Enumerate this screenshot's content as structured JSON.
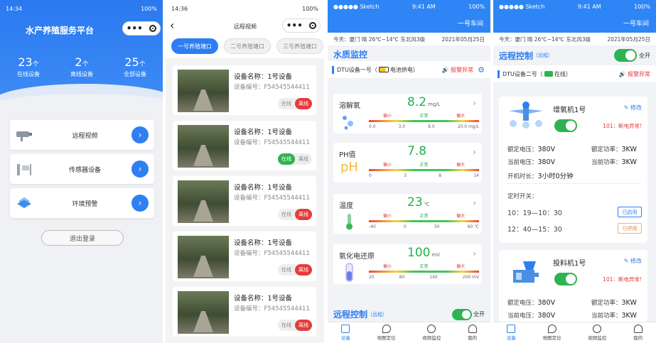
{
  "s1": {
    "time": "14:34",
    "battery": "100%",
    "title": "水产养殖服务平台",
    "stats": [
      {
        "n": "23",
        "u": "个",
        "l": "在线设备"
      },
      {
        "n": "2",
        "u": "个",
        "l": "离线设备"
      },
      {
        "n": "25",
        "u": "个",
        "l": "全部设备"
      }
    ],
    "menu": [
      {
        "label": "远程视频",
        "icon": "camera-icon"
      },
      {
        "label": "传感器设备",
        "icon": "sensor-icon"
      },
      {
        "label": "环境预警",
        "icon": "alert-icon"
      }
    ],
    "logout": "退出登录",
    "go": "›"
  },
  "s2": {
    "time": "14:36",
    "battery": "100%",
    "title": "远程视频",
    "back": "‹",
    "tabs": [
      "一号养殖塘口",
      "二号养殖塘口",
      "三号养殖塘口"
    ],
    "cards": [
      {
        "name": "设备名称：1号设备",
        "code": "设备编号：F54545544411",
        "online": "在线",
        "offline": "离线",
        "state": "offline"
      },
      {
        "name": "设备名称：1号设备",
        "code": "设备编号：F54545544411",
        "online": "在线",
        "offline": "离线",
        "state": "online"
      },
      {
        "name": "设备名称：1号设备",
        "code": "设备编号：F54545544411",
        "online": "在线",
        "offline": "离线",
        "state": "offline"
      },
      {
        "name": "设备名称：1号设备",
        "code": "设备编号：F54545544411",
        "online": "在线",
        "offline": "离线",
        "state": "offline"
      },
      {
        "name": "设备名称：1号设备",
        "code": "设备编号：F54545544411",
        "online": "在线",
        "offline": "离线",
        "state": "offline"
      }
    ]
  },
  "s3": {
    "carrier": "●●●●● Sketch",
    "time": "9:41 AM",
    "battery": "100%",
    "workshop": "一号车间",
    "weather": "今天：厦门 晴 26℃~14℃ 东北风3级",
    "date": "2021年05月25日",
    "section": "水质监控",
    "dtu": "DTU设备一号（",
    "power": "电池供电）",
    "alarm": "报警异常",
    "metrics": [
      {
        "name": "溶解氧",
        "value": "8.2",
        "unit": "mg/L",
        "low": "偏小",
        "mid": "正常",
        "high": "偏大",
        "ticks": [
          "0.0",
          "3.0",
          "8.0",
          "20.0 mg/L"
        ]
      },
      {
        "name": "PH值",
        "value": "7.8",
        "unit": "",
        "low": "偏小",
        "mid": "正常",
        "high": "偏大",
        "ticks": [
          "0",
          "3",
          "8",
          "14"
        ]
      },
      {
        "name": "温度",
        "value": "23",
        "unit": "℃",
        "low": "偏小",
        "mid": "正常",
        "high": "偏大",
        "ticks": [
          "-40",
          "0",
          "30",
          "60 ℃"
        ]
      },
      {
        "name": "氧化电还原",
        "value": "100",
        "unit": "mV",
        "low": "偏小",
        "mid": "正常",
        "high": "偏大",
        "ticks": [
          "20",
          "80",
          "140",
          "200 mV"
        ]
      }
    ],
    "remote": "远程控制",
    "remote_sub": "（远程）",
    "all_on": "全开",
    "tabs": [
      "设备",
      "地图定位",
      "视频监控",
      "我的"
    ]
  },
  "s4": {
    "carrier": "●●●●● Sketch",
    "time": "9:41 AM",
    "battery": "100%",
    "workshop": "一号车间",
    "weather": "今天：厦门 晴 26℃~14℃ 东北风3级",
    "date": "2021年05月25日",
    "section": "远程控制",
    "section_sub": "（远程）",
    "all_on": "全开",
    "dtu": "DTU设备二号（",
    "status": "在线）",
    "alarm": "报警异常",
    "m1": {
      "name": "增氧机1号",
      "edit": "修改",
      "err": "101：断电异常!",
      "rv_l": "额定电压：",
      "rv": "380V",
      "rp_l": "额定功率：",
      "rp": "3KW",
      "cv_l": "当前电压：",
      "cv": "380V",
      "cp_l": "当前功率：",
      "cp": "3KW",
      "rt_l": "开机时长：",
      "rt": "3小时0分钟",
      "timer": "定时开关：",
      "t1": "10：19—10：30",
      "t1b": "已启用",
      "t2": "12：40—15：30",
      "t2b": "已停用"
    },
    "m2": {
      "name": "投料机1号",
      "edit": "修改",
      "err": "101：断电异常!",
      "rv_l": "额定电压：",
      "rv": "380V",
      "rp_l": "额定功率：",
      "rp": "3KW",
      "cv_l": "当前电压：",
      "cv": "380V",
      "cp_l": "当前功率：",
      "cp": "3KW"
    },
    "tabs": [
      "设备",
      "地图定位",
      "视频监控",
      "我的"
    ]
  }
}
